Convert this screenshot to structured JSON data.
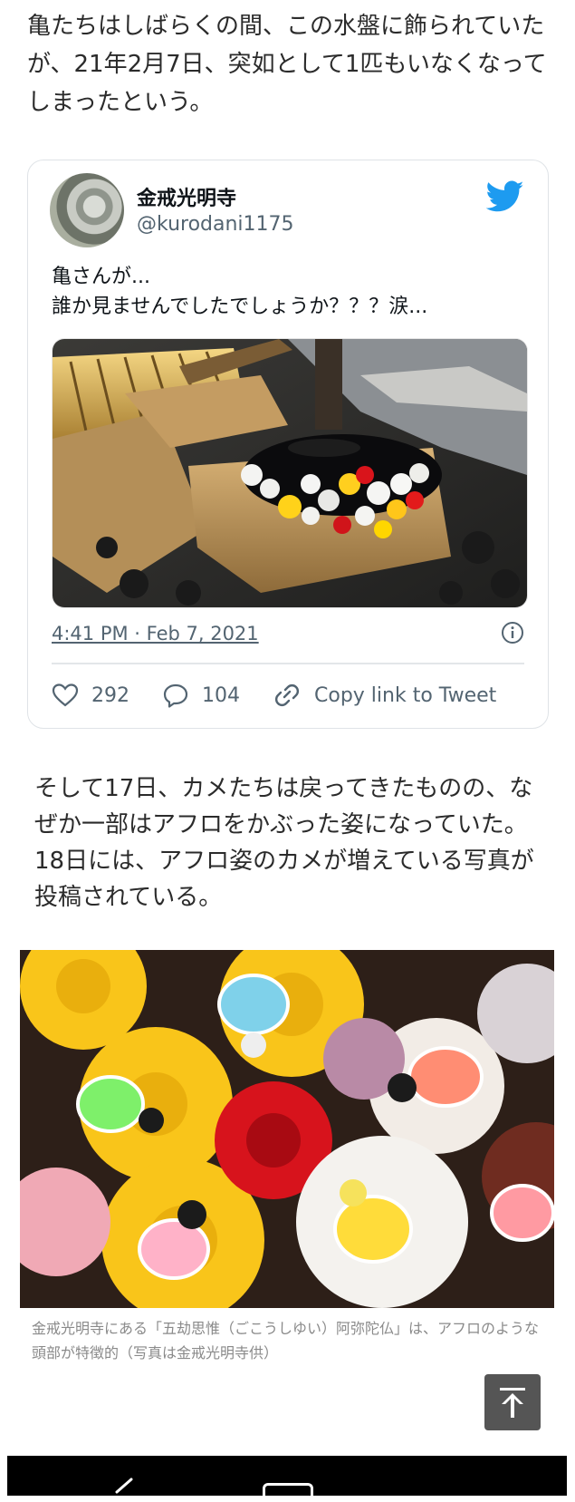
{
  "article": {
    "para1": "亀たちはしばらくの間、この水盤に飾られていたが、21年2月7日、突如として1匹もいなくなってしまったという。",
    "para2": "そして17日、カメたちは戻ってきたものの、なぜか一部はアフロをかぶった姿になっていた。18日には、アフロ姿のカメが増えている写真が投稿されている。",
    "caption": "金戒光明寺にある「五劫思惟（ごこうしゆい）阿弥陀仏」は、アフロのような頭部が特徴的（写真は金戒光明寺供）"
  },
  "tweet": {
    "author_name": "金戒光明寺",
    "author_handle": "@kurodani1175",
    "text_lines": [
      "亀さんが...",
      "誰か見ませんでしたでしょうか？？？涙..."
    ],
    "timestamp": "4:41 PM · Feb 7, 2021",
    "likes": "292",
    "replies": "104",
    "copy_link": "Copy link to Tweet",
    "brand_color": "#1d9bf0"
  },
  "icons": [
    "twitter-bird-icon",
    "info-icon",
    "heart-icon",
    "reply-icon",
    "link-icon",
    "arrow-up-icon",
    "back-icon",
    "home-icon"
  ]
}
